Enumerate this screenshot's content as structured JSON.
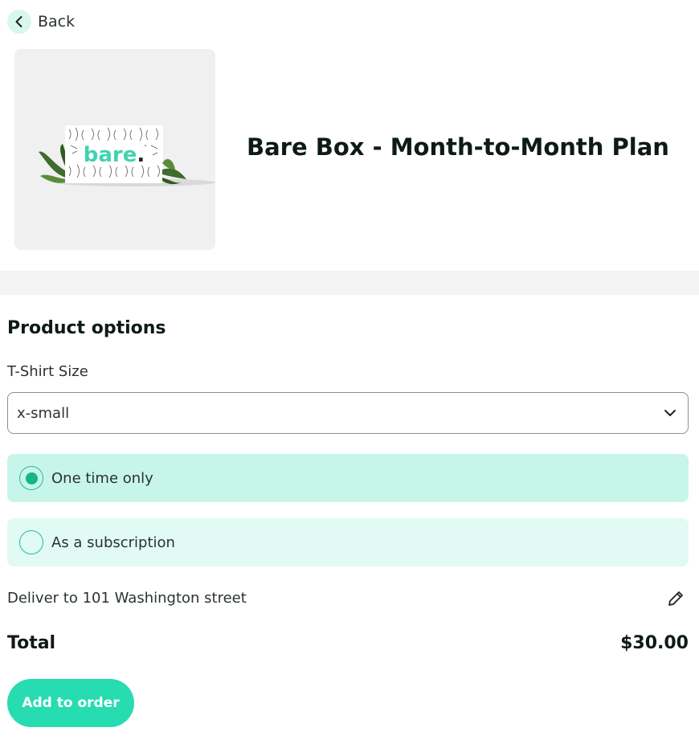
{
  "nav": {
    "back_label": "Back",
    "back_icon": "chevron-left-icon"
  },
  "product": {
    "title": "Bare Box - Month-to-Month Plan",
    "image_brand_text": "bare."
  },
  "options": {
    "section_title": "Product options",
    "size_label": "T-Shirt Size",
    "size_value": "x-small",
    "purchase_types": [
      {
        "label": "One time only",
        "selected": true
      },
      {
        "label": "As a subscription",
        "selected": false
      }
    ]
  },
  "delivery": {
    "text": "Deliver to 101 Washington street",
    "edit_icon": "pencil-icon"
  },
  "summary": {
    "total_label": "Total",
    "total_value": "$30.00"
  },
  "actions": {
    "add_label": "Add to order"
  },
  "colors": {
    "accent": "#26dcb0",
    "selected_option_bg": "#c8f5ea",
    "unselected_option_bg": "#e1faf4",
    "radio_fill": "#16b58b",
    "back_circle_bg": "#d8f7ee"
  }
}
